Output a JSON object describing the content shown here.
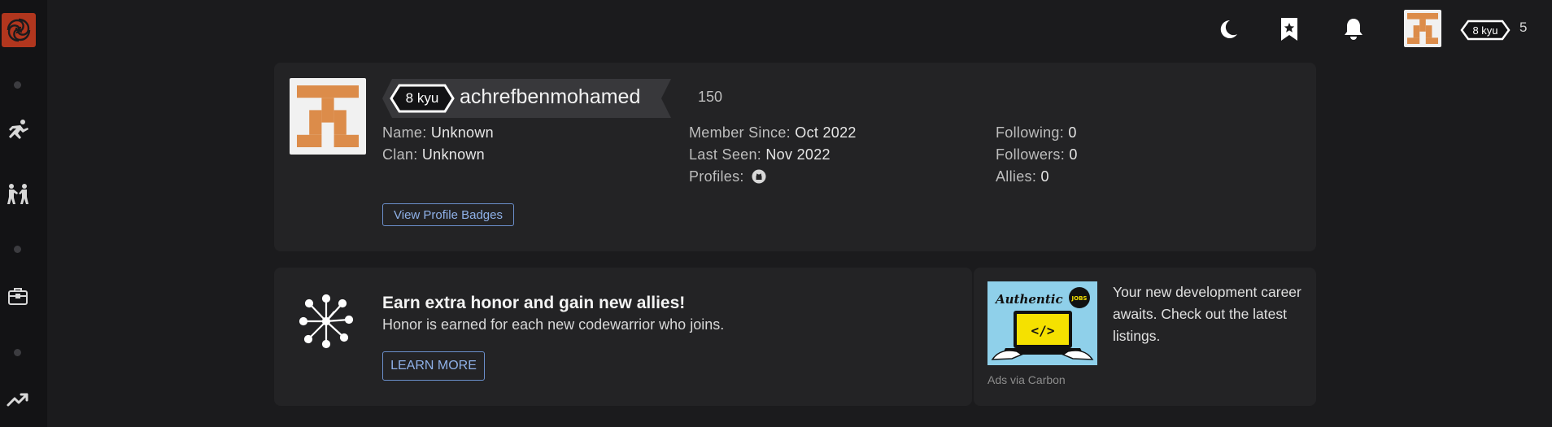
{
  "sidebar": {
    "logo_icon": "codewars-logo-icon",
    "items": [
      {
        "name": "training-icon"
      },
      {
        "name": "practice-icon"
      },
      {
        "name": "jobs-icon"
      },
      {
        "name": "leaderboards-icon"
      }
    ]
  },
  "topbar": {
    "theme_icon": "moon-icon",
    "bookmark_icon": "bookmark-star-icon",
    "notification_icon": "bell-icon",
    "rank": "8 kyu",
    "honor": "5"
  },
  "profile": {
    "rank": "8 kyu",
    "username": "achrefbenmohamed",
    "honor": "150",
    "name_label": "Name:",
    "name_value": "Unknown",
    "clan_label": "Clan:",
    "clan_value": "Unknown",
    "member_since_label": "Member Since:",
    "member_since_value": "Oct 2022",
    "last_seen_label": "Last Seen:",
    "last_seen_value": "Nov 2022",
    "profiles_label": "Profiles:",
    "profiles_icon": "github-icon",
    "following_label": "Following:",
    "following_value": "0",
    "followers_label": "Followers:",
    "followers_value": "0",
    "allies_label": "Allies:",
    "allies_value": "0",
    "badges_button": "View Profile Badges"
  },
  "honor_card": {
    "title": "Earn extra honor and gain new allies!",
    "description": "Honor is earned for each new codewarrior who joins.",
    "button": "LEARN MORE"
  },
  "ad": {
    "image_title": "Authentic",
    "image_badge": "JOBS",
    "text": "Your new development career awaits. Check out the latest listings.",
    "credit": "Ads via Carbon"
  },
  "colors": {
    "background": "#1b1b1d",
    "card": "#232325",
    "sidebar": "#131315",
    "brand": "#b1361e",
    "accent_link": "#8fb1e8",
    "avatar_identicon": "#dc8c4a"
  }
}
